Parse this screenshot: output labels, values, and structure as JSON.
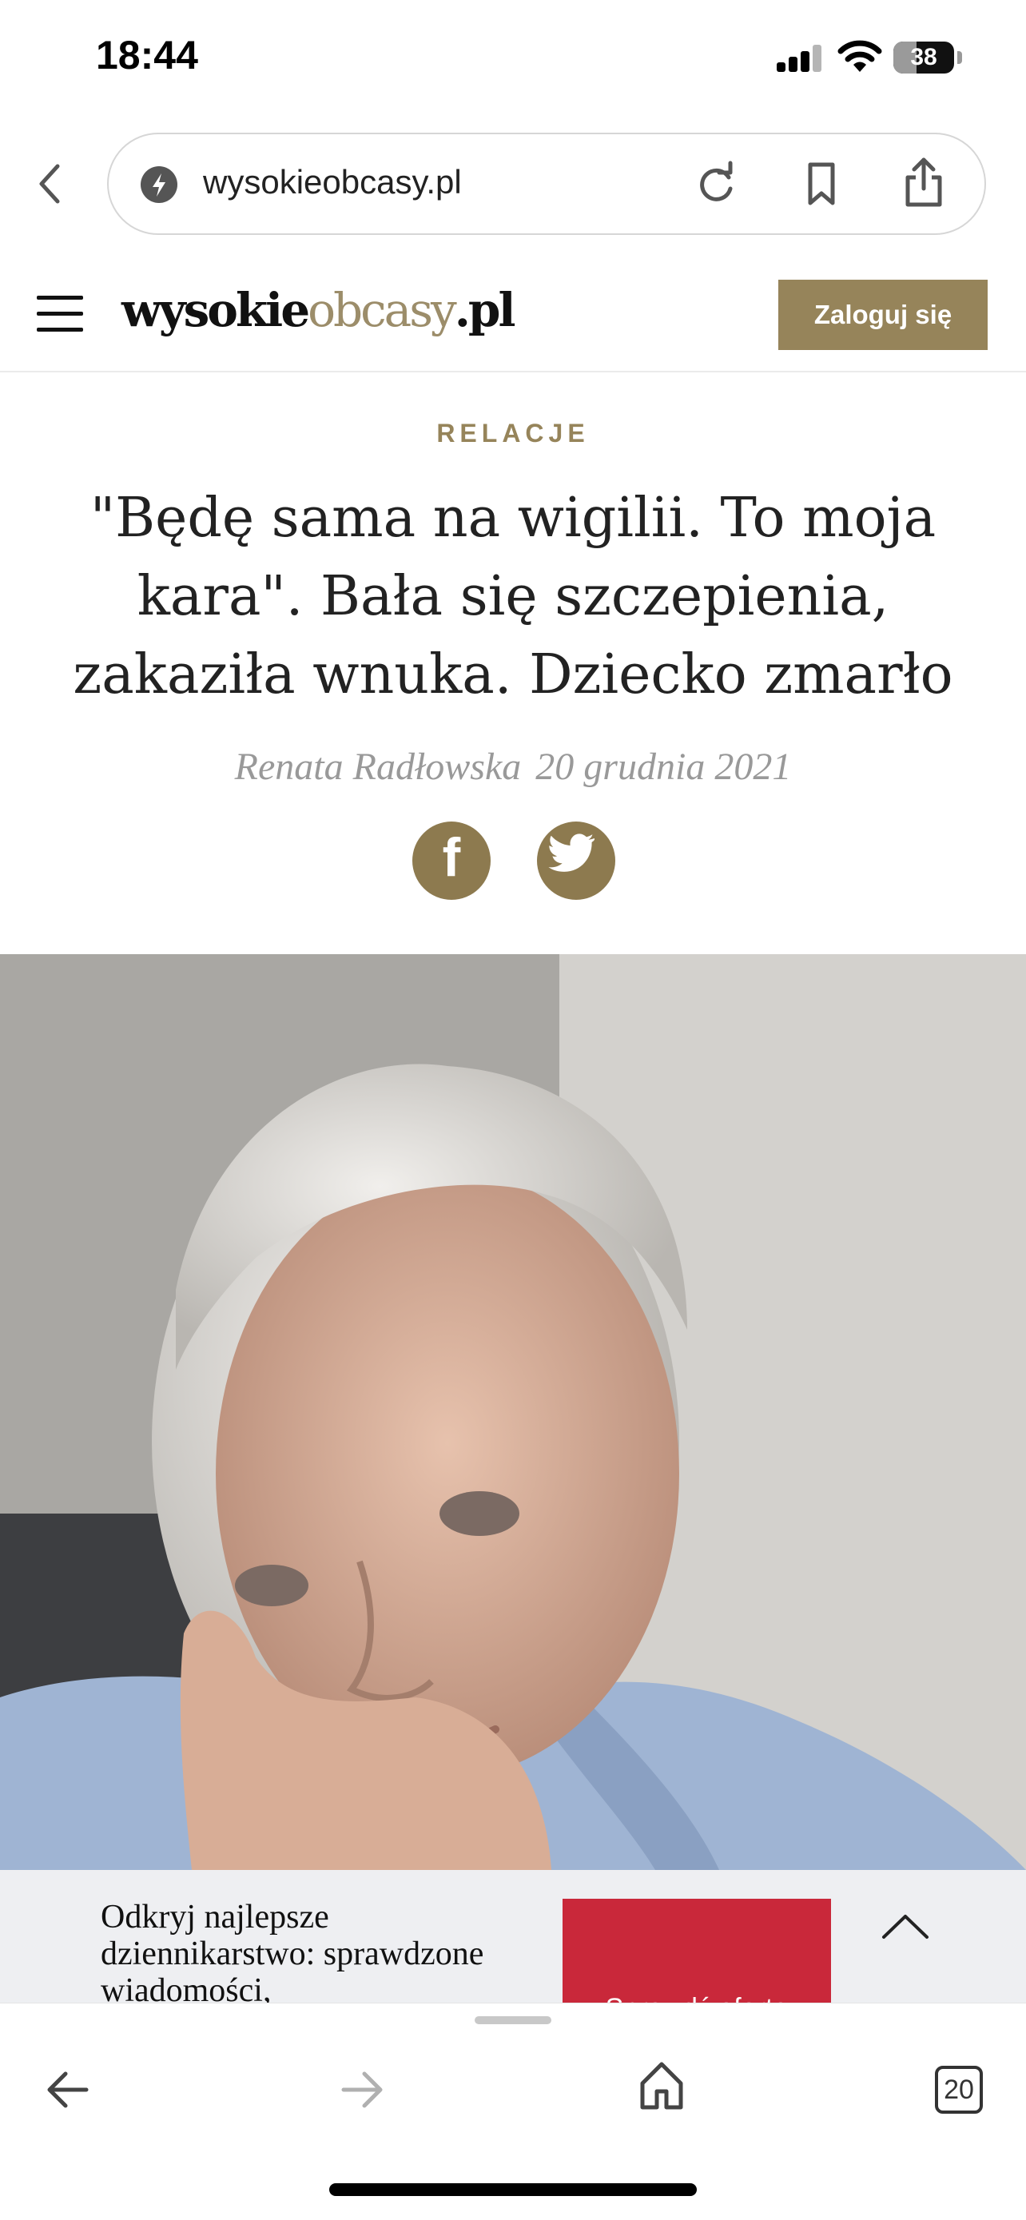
{
  "status_bar": {
    "time": "18:44",
    "battery": "38",
    "battery_level": 0.38,
    "icons": [
      "signal-icon",
      "wifi-icon",
      "battery-icon"
    ]
  },
  "browser": {
    "url": "wysokieobcasy.pl",
    "icons": [
      "back-chevron-icon",
      "site-icon",
      "reload-icon",
      "bookmark-icon",
      "share-icon"
    ]
  },
  "site_header": {
    "logo_primary": "wysokie",
    "logo_accent": "obcasy",
    "logo_suffix": ".pl",
    "login_label": "Zaloguj się",
    "menu_icon": "hamburger-icon"
  },
  "article": {
    "category": "RELACJE",
    "headline": "\"Będę sama na wigilii. To moja kara\". Bała się szczepienia, zakaziła wnuka. Dziecko zmarło",
    "author": "Renata Radłowska",
    "date": "20 grudnia 2021",
    "share": {
      "facebook_glyph": "f",
      "facebook_icon": "facebook-icon",
      "twitter_icon": "twitter-icon"
    }
  },
  "promo": {
    "text": "Odkryj najlepsze dziennikarstwo: sprawdzone wiadomości,",
    "button_partial": "Sprawdź ofertę",
    "collapse_icon": "chevron-up-icon"
  },
  "toolbar": {
    "tab_count": "20",
    "icons": [
      "back-arrow-icon",
      "forward-arrow-icon",
      "home-icon",
      "tabs-icon"
    ]
  },
  "colors": {
    "brand_gold": "#96845a",
    "promo_red": "#c9283a",
    "byline_grey": "#999999"
  }
}
